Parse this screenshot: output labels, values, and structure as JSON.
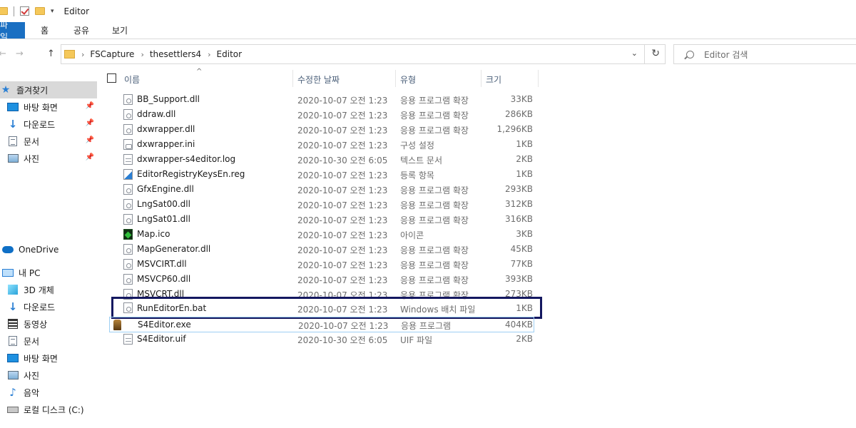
{
  "window": {
    "title": "Editor"
  },
  "ribbon": {
    "tabs": [
      "파일",
      "홈",
      "공유",
      "보기"
    ]
  },
  "address": {
    "crumbs": [
      "FSCapture",
      "thesettlers4",
      "Editor"
    ],
    "back_glyph": "←",
    "forward_glyph": "→",
    "up_glyph": "↑",
    "separator_glyph": "›",
    "dropdown_glyph": "⌄",
    "refresh_glyph": "↻"
  },
  "search": {
    "placeholder": "Editor 검색"
  },
  "sidebar": {
    "quick_access": "즐겨찾기",
    "pinned": [
      {
        "label": "바탕 화면",
        "icon": "desktop-icon"
      },
      {
        "label": "다운로드",
        "icon": "download-icon"
      },
      {
        "label": "문서",
        "icon": "document-icon"
      },
      {
        "label": "사진",
        "icon": "pictures-icon"
      }
    ],
    "onedrive": "OneDrive",
    "this_pc": "내 PC",
    "pc_items": [
      {
        "label": "3D 개체",
        "icon": "3d-objects-icon"
      },
      {
        "label": "다운로드",
        "icon": "download-icon"
      },
      {
        "label": "동영상",
        "icon": "video-icon"
      },
      {
        "label": "문서",
        "icon": "document-icon"
      },
      {
        "label": "바탕 화면",
        "icon": "desktop-icon"
      },
      {
        "label": "사진",
        "icon": "pictures-icon"
      },
      {
        "label": "음악",
        "icon": "music-icon"
      },
      {
        "label": "로컬 디스크 (C:)",
        "icon": "drive-icon"
      }
    ]
  },
  "columns": {
    "name": "이름",
    "date": "수정한 날짜",
    "type": "유형",
    "size": "크기",
    "sort_glyph": "^"
  },
  "files": [
    {
      "name": "BB_Support.dll",
      "date": "2020-10-07 오전 1:23",
      "type": "응용 프로그램 확장",
      "size": "33KB",
      "kind": "dll"
    },
    {
      "name": "ddraw.dll",
      "date": "2020-10-07 오전 1:23",
      "type": "응용 프로그램 확장",
      "size": "286KB",
      "kind": "dll"
    },
    {
      "name": "dxwrapper.dll",
      "date": "2020-10-07 오전 1:23",
      "type": "응용 프로그램 확장",
      "size": "1,296KB",
      "kind": "dll"
    },
    {
      "name": "dxwrapper.ini",
      "date": "2020-10-07 오전 1:23",
      "type": "구성 설정",
      "size": "1KB",
      "kind": "ini"
    },
    {
      "name": "dxwrapper-s4editor.log",
      "date": "2020-10-30 오전 6:05",
      "type": "텍스트 문서",
      "size": "2KB",
      "kind": "txt"
    },
    {
      "name": "EditorRegistryKeysEn.reg",
      "date": "2020-10-07 오전 1:23",
      "type": "등록 항목",
      "size": "1KB",
      "kind": "reg"
    },
    {
      "name": "GfxEngine.dll",
      "date": "2020-10-07 오전 1:23",
      "type": "응용 프로그램 확장",
      "size": "293KB",
      "kind": "dll"
    },
    {
      "name": "LngSat00.dll",
      "date": "2020-10-07 오전 1:23",
      "type": "응용 프로그램 확장",
      "size": "312KB",
      "kind": "dll"
    },
    {
      "name": "LngSat01.dll",
      "date": "2020-10-07 오전 1:23",
      "type": "응용 프로그램 확장",
      "size": "316KB",
      "kind": "dll"
    },
    {
      "name": "Map.ico",
      "date": "2020-10-07 오전 1:23",
      "type": "아이콘",
      "size": "3KB",
      "kind": "ico"
    },
    {
      "name": "MapGenerator.dll",
      "date": "2020-10-07 오전 1:23",
      "type": "응용 프로그램 확장",
      "size": "45KB",
      "kind": "dll"
    },
    {
      "name": "MSVCIRT.dll",
      "date": "2020-10-07 오전 1:23",
      "type": "응용 프로그램 확장",
      "size": "77KB",
      "kind": "dll"
    },
    {
      "name": "MSVCP60.dll",
      "date": "2020-10-07 오전 1:23",
      "type": "응용 프로그램 확장",
      "size": "393KB",
      "kind": "dll"
    },
    {
      "name": "MSVCRT.dll",
      "date": "2020-10-07 오전 1:23",
      "type": "응용 프로그램 확장",
      "size": "273KB",
      "kind": "dll"
    },
    {
      "name": "RunEditorEn.bat",
      "date": "2020-10-07 오전 1:23",
      "type": "Windows 배치 파일",
      "size": "1KB",
      "kind": "dll"
    },
    {
      "name": "S4Editor.exe",
      "date": "2020-10-07 오전 1:23",
      "type": "응용 프로그램",
      "size": "404KB",
      "kind": "exe"
    },
    {
      "name": "S4Editor.uif",
      "date": "2020-10-30 오전 6:05",
      "type": "UIF 파일",
      "size": "2KB",
      "kind": "txt"
    }
  ],
  "colors": {
    "file_tab": "#1a6fc2",
    "highlight_box": "#141860",
    "focus_border": "#9ecff3",
    "selected_nav": "#d9d9d9"
  }
}
